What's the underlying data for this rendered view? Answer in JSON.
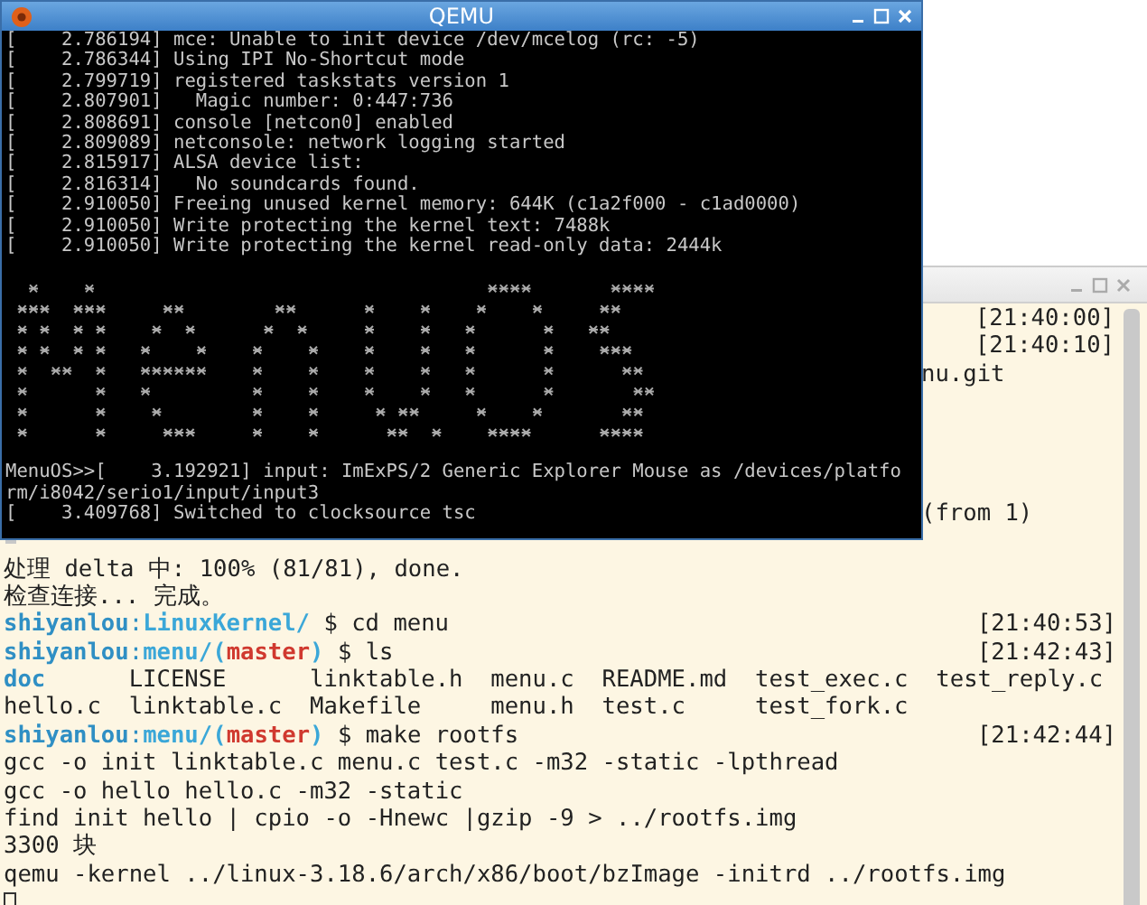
{
  "qemu": {
    "title": "QEMU",
    "console": [
      {
        "kind": "log",
        "text": "[    2.786194] mce: Unable to init device /dev/mcelog (rc: -5)"
      },
      {
        "kind": "log",
        "text": "[    2.786344] Using IPI No-Shortcut mode"
      },
      {
        "kind": "log",
        "text": "[    2.799719] registered taskstats version 1"
      },
      {
        "kind": "log",
        "text": "[    2.807901]   Magic number: 0:447:736"
      },
      {
        "kind": "log",
        "text": "[    2.808691] console [netcon0] enabled"
      },
      {
        "kind": "log",
        "text": "[    2.809089] netconsole: network logging started"
      },
      {
        "kind": "log",
        "text": "[    2.815917] ALSA device list:"
      },
      {
        "kind": "log",
        "text": "[    2.816314]   No soundcards found."
      },
      {
        "kind": "log",
        "text": "[    2.910050] Freeing unused kernel memory: 644K (c1a2f000 - c1ad0000)"
      },
      {
        "kind": "log",
        "text": "[    2.910050] Write protecting the kernel text: 7488k"
      },
      {
        "kind": "log",
        "text": "[    2.910050] Write protecting the kernel read-only data: 2444k"
      },
      {
        "kind": "blank"
      },
      {
        "kind": "logo"
      },
      {
        "kind": "blank"
      },
      {
        "kind": "log",
        "text": "MenuOS>>[    3.192921] input: ImExPS/2 Generic Explorer Mouse as /devices/platfo"
      },
      {
        "kind": "log",
        "text": "rm/i8042/serio1/input/input3"
      },
      {
        "kind": "log",
        "text": "[    3.409768] Switched to clocksource tsc"
      },
      {
        "kind": "cursor"
      }
    ]
  },
  "terminal": {
    "rows": [
      {
        "kind": "time",
        "text": "[21:40:00]"
      },
      {
        "kind": "time",
        "text": "[21:40:10]"
      },
      {
        "kind": "tail",
        "text": "nu.git"
      },
      {
        "kind": "covered"
      },
      {
        "kind": "covered"
      },
      {
        "kind": "covered"
      },
      {
        "kind": "covered"
      },
      {
        "kind": "tail",
        "text": "(from 1)"
      },
      {
        "kind": "covered"
      },
      {
        "kind": "text",
        "text": "处理 delta 中: 100% (81/81), done."
      },
      {
        "kind": "text",
        "text": "检查连接... 完成。"
      },
      {
        "kind": "prompt",
        "user": "shiyanlou",
        "separator": ":",
        "path": "LinuxKernel/",
        "symbol": "$",
        "command": "cd menu",
        "time": "[21:40:53]"
      },
      {
        "kind": "prompt",
        "user": "shiyanlou",
        "separator": ":",
        "path": "menu/",
        "branch": {
          "open": "(",
          "name": "master",
          "close": ")"
        },
        "symbol": "$",
        "command": "ls",
        "time": "[21:42:43]"
      },
      {
        "kind": "files",
        "files": [
          {
            "name": "doc",
            "dir": true
          },
          {
            "name": "LICENSE",
            "dir": false
          },
          {
            "name": "linktable.h",
            "dir": false
          },
          {
            "name": "menu.c",
            "dir": false
          },
          {
            "name": "README.md",
            "dir": false
          },
          {
            "name": "test_exec.c",
            "dir": false
          },
          {
            "name": "test_reply.c",
            "dir": false
          }
        ]
      },
      {
        "kind": "files",
        "files": [
          {
            "name": "hello.c",
            "dir": false
          },
          {
            "name": "linktable.c",
            "dir": false
          },
          {
            "name": "Makefile",
            "dir": false
          },
          {
            "name": "menu.h",
            "dir": false
          },
          {
            "name": "test.c",
            "dir": false
          },
          {
            "name": "test_fork.c",
            "dir": false
          }
        ]
      },
      {
        "kind": "prompt",
        "user": "shiyanlou",
        "separator": ":",
        "path": "menu/",
        "branch": {
          "open": "(",
          "name": "master",
          "close": ")"
        },
        "symbol": "$",
        "command": "make rootfs",
        "time": "[21:42:44]"
      },
      {
        "kind": "text",
        "text": "gcc -o init linktable.c menu.c test.c -m32 -static -lpthread"
      },
      {
        "kind": "text",
        "text": "gcc -o hello hello.c -m32 -static"
      },
      {
        "kind": "text",
        "text": "find init hello | cpio -o -Hnewc |gzip -9 > ../rootfs.img"
      },
      {
        "kind": "text",
        "text": "3300 块"
      },
      {
        "kind": "text",
        "text": "qemu -kernel ../linux-3.18.6/arch/x86/boot/bzImage -initrd ../rootfs.img"
      },
      {
        "kind": "cursor"
      }
    ]
  }
}
